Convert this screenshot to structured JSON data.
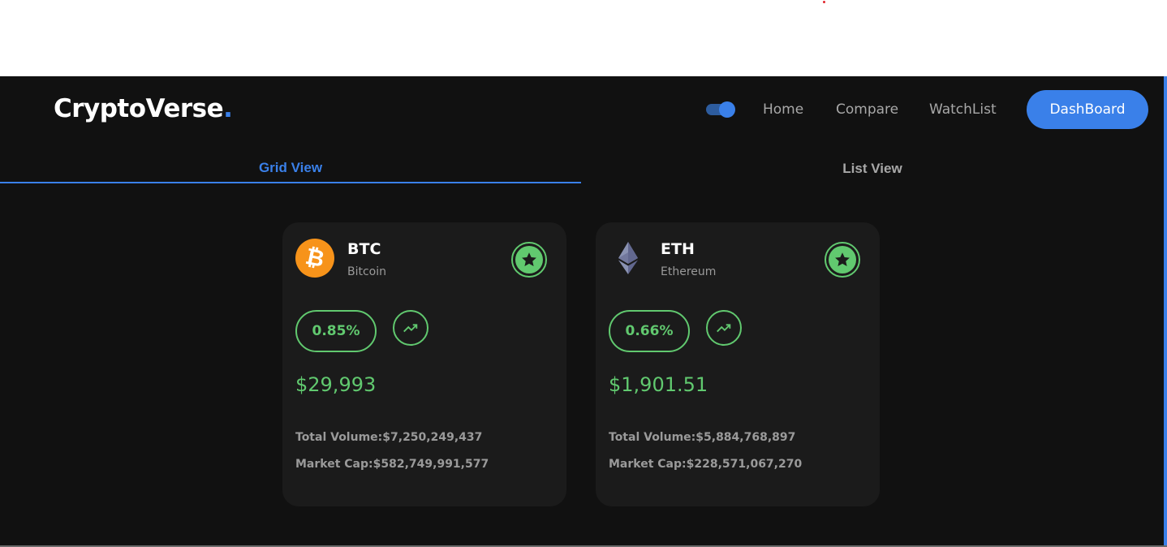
{
  "brand": {
    "name": "CryptoVerse",
    "dot": ".",
    "accent": "#3a80e9"
  },
  "nav": {
    "theme_toggle": "on",
    "links": [
      "Home",
      "Compare",
      "WatchList"
    ],
    "cta": "DashBoard"
  },
  "tabs": [
    {
      "label": "Grid View",
      "active": true
    },
    {
      "label": "List View",
      "active": false
    }
  ],
  "coins": [
    {
      "symbol": "BTC",
      "name": "Bitcoin",
      "icon": "bitcoin-logo-icon",
      "change": "0.85%",
      "trend": "up",
      "price": "$29,993",
      "volume_label": "Total Volume:",
      "volume": "$7,250,249,437",
      "cap_label": "Market Cap:",
      "cap": "$582,749,991,577",
      "watchlisted": true
    },
    {
      "symbol": "ETH",
      "name": "Ethereum",
      "icon": "ethereum-logo-icon",
      "change": "0.66%",
      "trend": "up",
      "price": "$1,901.51",
      "volume_label": "Total Volume:",
      "volume": "$5,884,768,897",
      "cap_label": "Market Cap:",
      "cap": "$228,571,067,270",
      "watchlisted": true
    }
  ],
  "colors": {
    "positive": "#61c96f",
    "background": "#111111",
    "card": "#1b1b1b"
  }
}
